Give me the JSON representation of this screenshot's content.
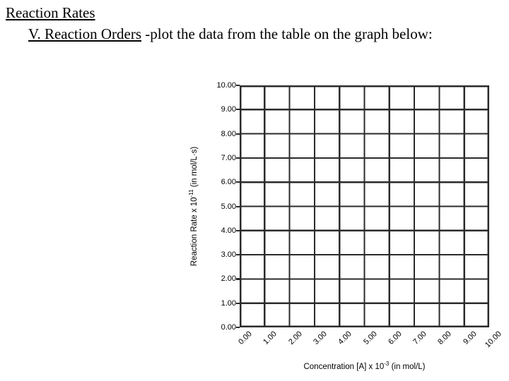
{
  "slide": {
    "title": "Reaction Rates",
    "subtitle_underlined": "V.  Reaction Orders",
    "subtitle_rest": " -plot the data from the table on the graph below:"
  },
  "chart_data": {
    "type": "scatter",
    "title": "",
    "subtitle": "",
    "xlabel_prefix": "Concentration [A] x 10",
    "xlabel_exponent": "-3",
    "xlabel_suffix": " (in mol/L)",
    "xlabel": "Concentration [A] x 10-3 (in mol/L)",
    "ylabel_prefix": "Reaction Rate x 10",
    "ylabel_exponent": "-11",
    "ylabel_suffix": " (in mol/L·s)",
    "ylabel": "Reaction Rate x 10-11 (in mol/L·s)",
    "x_tick_labels": [
      "0.00",
      "1.00",
      "2.00",
      "3.00",
      "4.00",
      "5.00",
      "6.00",
      "7.00",
      "8.00",
      "9.00",
      "10.00"
    ],
    "y_tick_labels": [
      "10.00",
      "9.00",
      "8.00",
      "7.00",
      "6.00",
      "5.00",
      "4.00",
      "3.00",
      "2.00",
      "1.00",
      "0.00"
    ],
    "xlim": [
      0,
      10
    ],
    "ylim": [
      0,
      10
    ],
    "x_tick_step": 1,
    "y_tick_step": 1,
    "grid": true,
    "grid_columns": 10,
    "grid_rows": 10,
    "legend": "none",
    "series": [],
    "values": [],
    "categories": [],
    "note": "empty grid provided for the student to plot data points"
  },
  "style": {
    "grid_color": "#2b2b2b",
    "axis_color": "#1a1a1a",
    "background": "#ffffff",
    "text_color": "#000000"
  }
}
